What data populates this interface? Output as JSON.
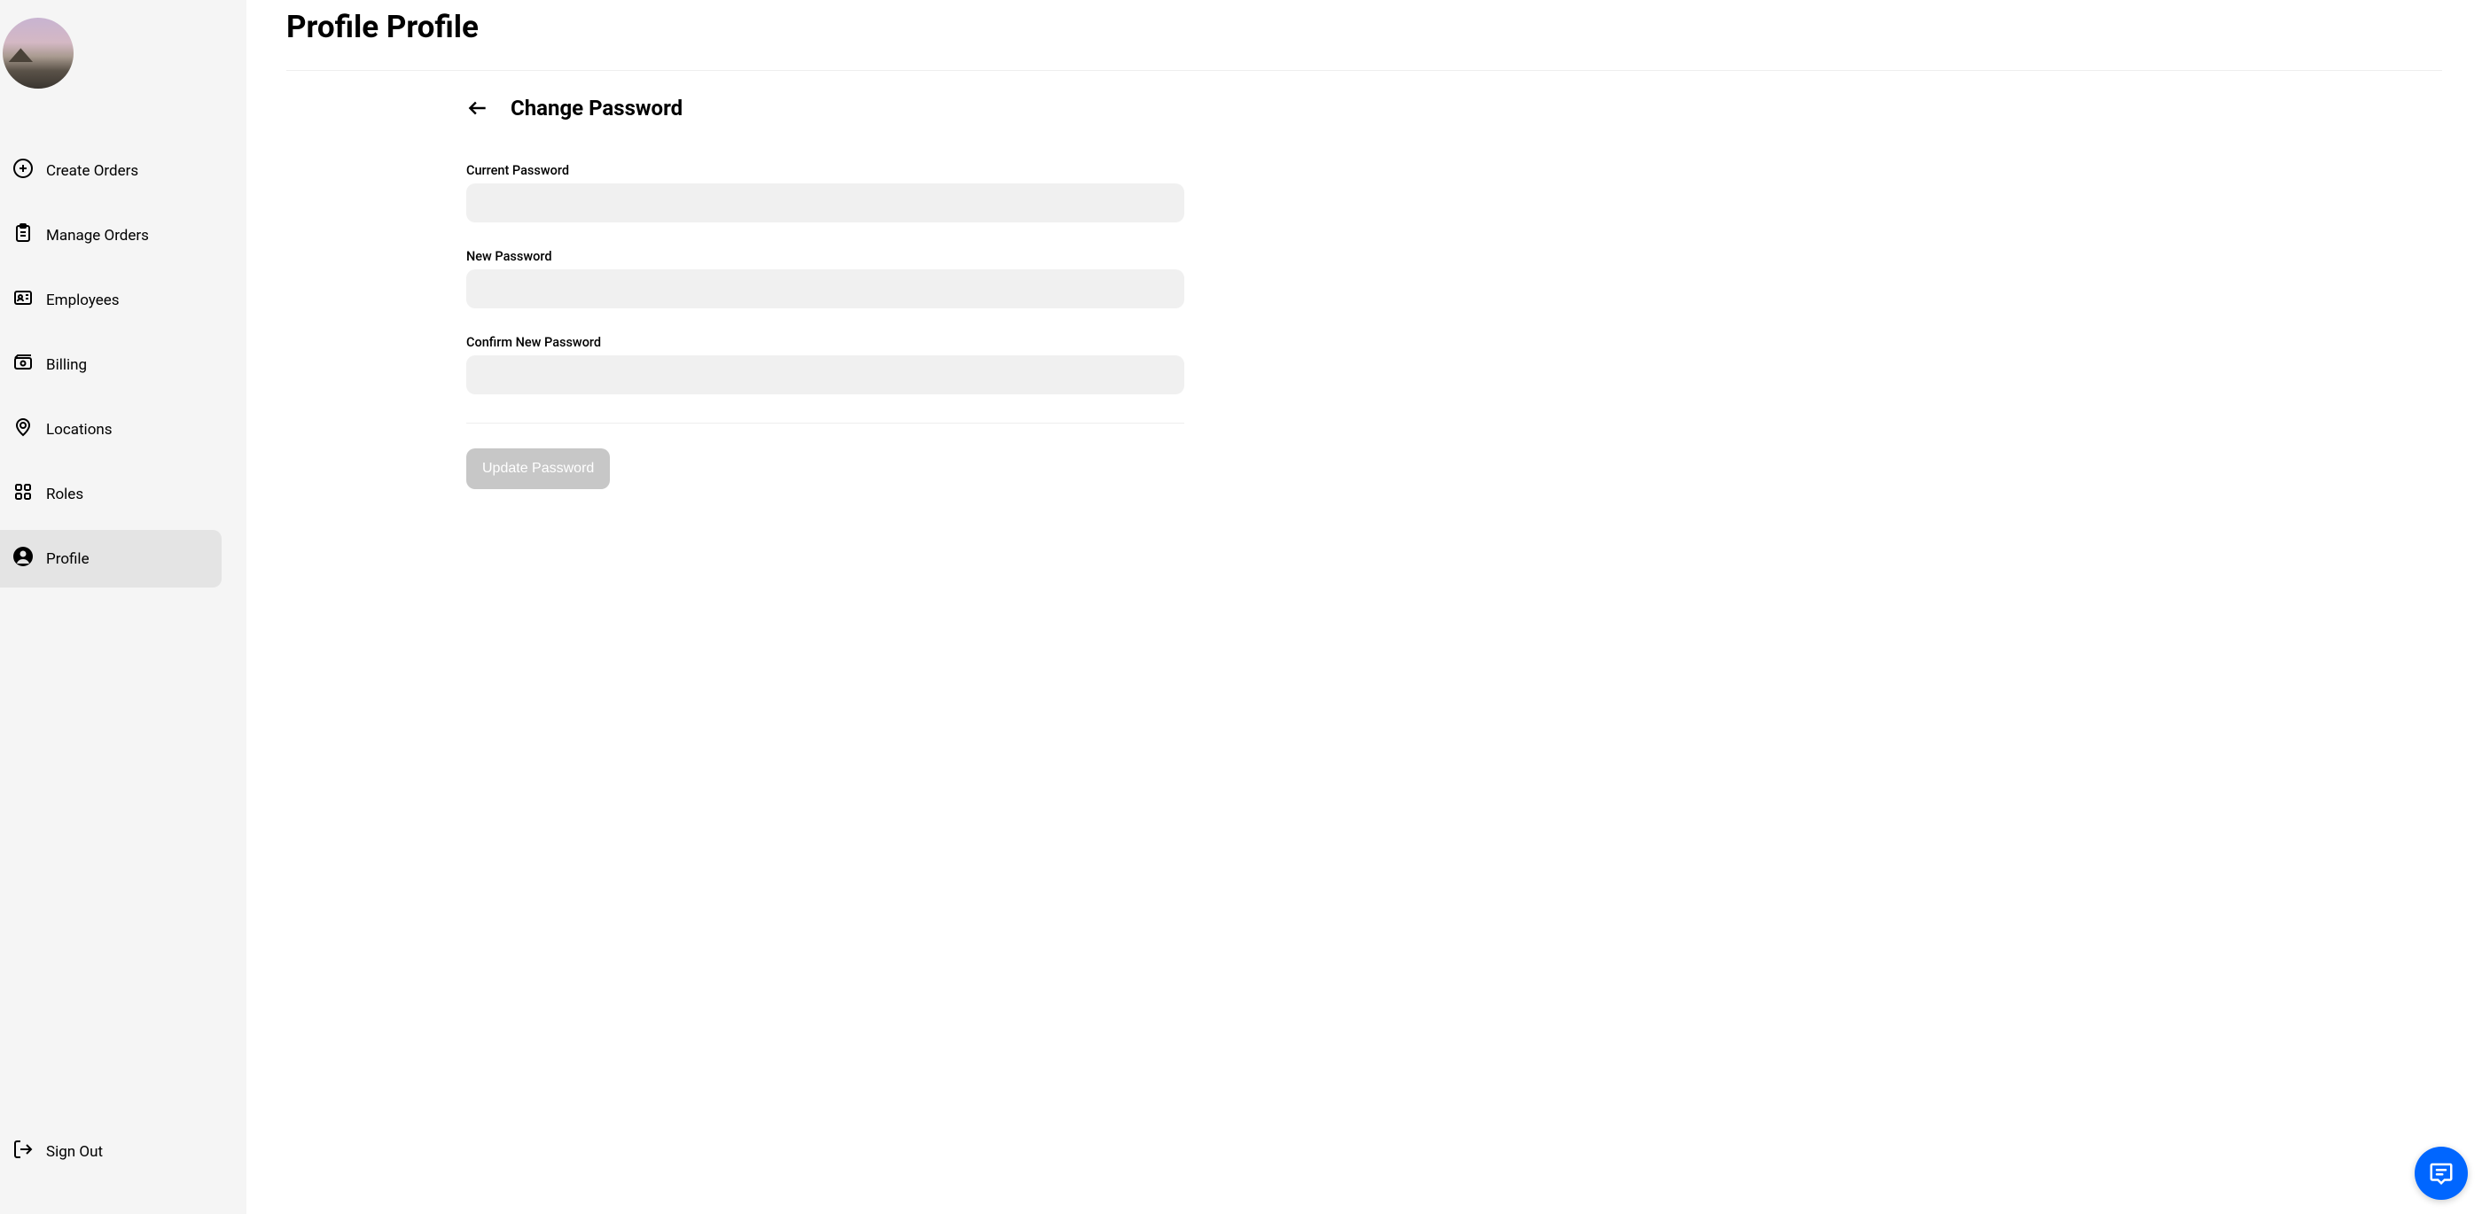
{
  "sidebar": {
    "items": [
      {
        "label": "Create Orders"
      },
      {
        "label": "Manage Orders"
      },
      {
        "label": "Employees"
      },
      {
        "label": "Billing"
      },
      {
        "label": "Locations"
      },
      {
        "label": "Roles"
      },
      {
        "label": "Profile"
      }
    ],
    "signOutLabel": "Sign Out"
  },
  "page": {
    "title": "Profile Profile",
    "sectionTitle": "Change Password"
  },
  "form": {
    "currentPassword": {
      "label": "Current Password",
      "value": ""
    },
    "newPassword": {
      "label": "New Password",
      "value": ""
    },
    "confirmPassword": {
      "label": "Confirm New Password",
      "value": ""
    },
    "submitLabel": "Update Password"
  }
}
